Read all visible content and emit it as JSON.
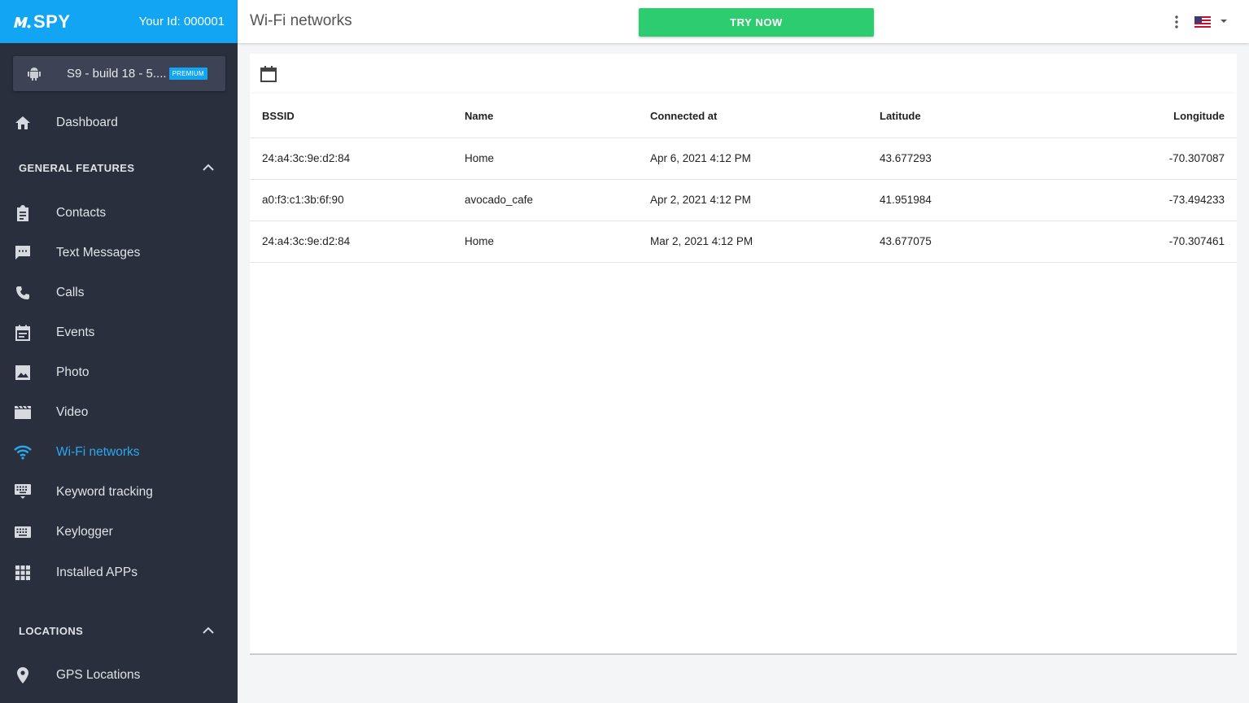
{
  "brand": {
    "logo_text": "SPY",
    "user_id": "Your Id: 000001",
    "color": "#12a5f4"
  },
  "device": {
    "name": "S9 - build 18 - 5....",
    "badge": "PREMIUM"
  },
  "nav": {
    "dashboard": "Dashboard",
    "general_section": "GENERAL FEATURES",
    "items": [
      {
        "label": "Contacts",
        "icon": "clipboard-icon"
      },
      {
        "label": "Text Messages",
        "icon": "message-icon"
      },
      {
        "label": "Calls",
        "icon": "phone-icon"
      },
      {
        "label": "Events",
        "icon": "calendar-icon"
      },
      {
        "label": "Photo",
        "icon": "image-icon"
      },
      {
        "label": "Video",
        "icon": "film-icon"
      },
      {
        "label": "Wi-Fi networks",
        "icon": "wifi-icon",
        "active": true
      },
      {
        "label": "Keyword tracking",
        "icon": "keyboard-hide-icon"
      },
      {
        "label": "Keylogger",
        "icon": "keyboard-icon"
      },
      {
        "label": "Installed APPs",
        "icon": "apps-grid-icon"
      }
    ],
    "locations_section": "LOCATIONS",
    "gps": "GPS Locations",
    "active_color": "#2aa8f2"
  },
  "topbar": {
    "title": "Wi-Fi networks",
    "try_now": "TRY NOW",
    "try_color": "#2ecc71"
  },
  "table": {
    "headers": [
      "BSSID",
      "Name",
      "Connected at",
      "Latitude",
      "Longitude"
    ],
    "rows": [
      [
        "24:a4:3c:9e:d2:84",
        "Home",
        "Apr 6, 2021 4:12 PM",
        "43.677293",
        "-70.307087"
      ],
      [
        "a0:f3:c1:3b:6f:90",
        "avocado_cafe",
        "Apr 2, 2021 4:12 PM",
        "41.951984",
        "-73.494233"
      ],
      [
        "24:a4:3c:9e:d2:84",
        "Home",
        "Mar 2, 2021 4:12 PM",
        "43.677075",
        "-70.307461"
      ]
    ]
  }
}
